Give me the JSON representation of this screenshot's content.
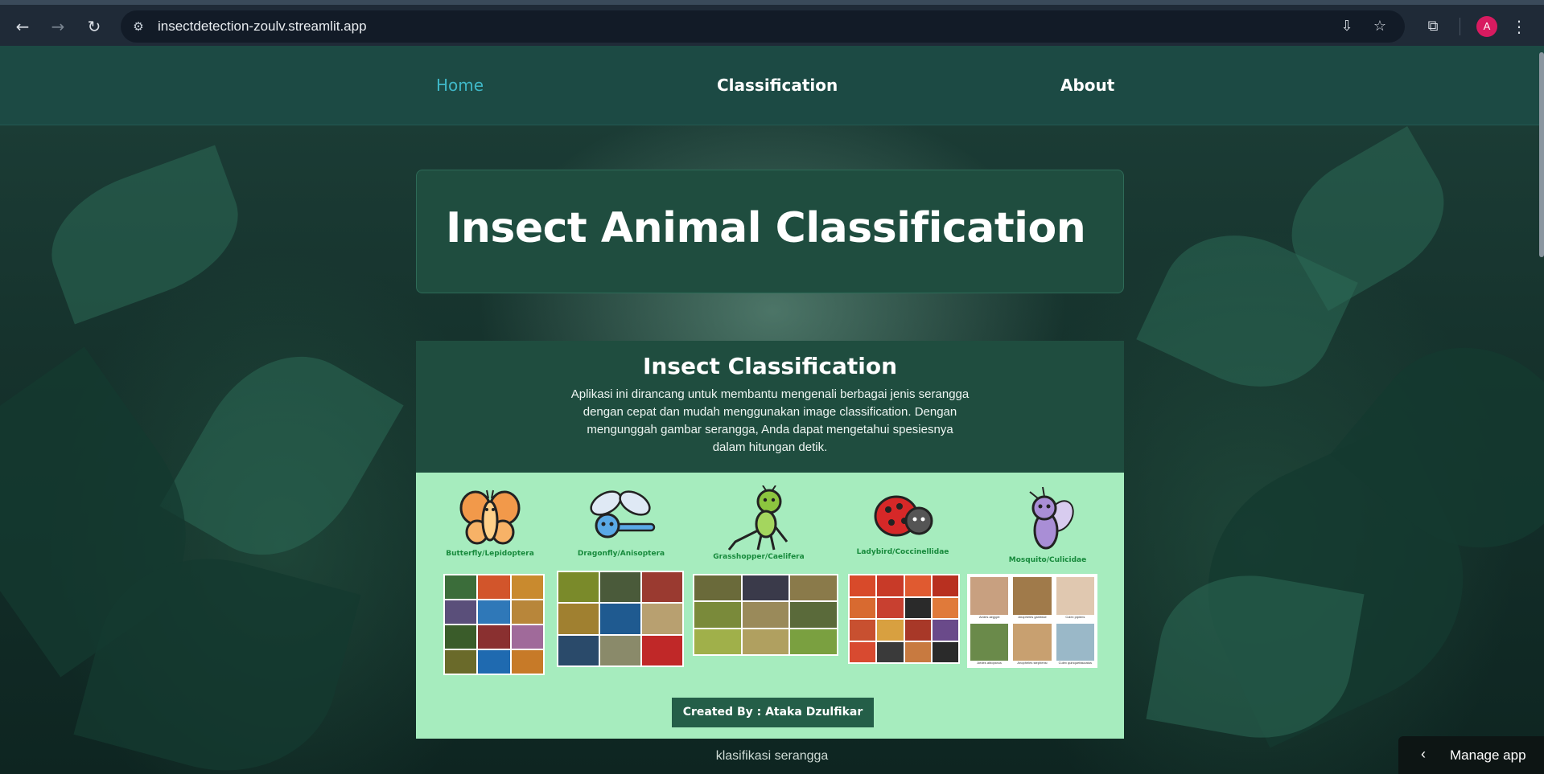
{
  "browser": {
    "url": "insectdetection-zoulv.streamlit.app",
    "back_icon": "arrow-left-icon",
    "forward_icon": "arrow-right-icon",
    "reload_icon": "reload-icon",
    "avatar_letter": "A"
  },
  "nav": {
    "items": [
      {
        "label": "Home",
        "active": true
      },
      {
        "label": "Classification",
        "active": false
      },
      {
        "label": "About",
        "active": false
      }
    ]
  },
  "title_card": {
    "title": "Insect Animal Classification"
  },
  "insect_section": {
    "heading": "Insect Classification",
    "description": "Aplikasi ini dirancang untuk membantu mengenali berbagai jenis serangga dengan cepat dan mudah menggunakan image classification. Dengan mengunggah gambar serangga, Anda dapat mengetahui spesiesnya dalam hitungan detik.",
    "insects": [
      {
        "caption": "Butterfly/Lepidoptera",
        "mascot": "butterfly-icon",
        "color": "#f2994a"
      },
      {
        "caption": "Dragonfly/Anisoptera",
        "mascot": "dragonfly-icon",
        "color": "#5aa9e6"
      },
      {
        "caption": "Grasshopper/Caelifera",
        "mascot": "grasshopper-icon",
        "color": "#8cc63f"
      },
      {
        "caption": "Ladybird/Coccinellidae",
        "mascot": "ladybird-icon",
        "color": "#d62828"
      },
      {
        "caption": "Mosquito/Culicidae",
        "mascot": "mosquito-icon",
        "color": "#a98ed6"
      }
    ],
    "mosquito_labels": [
      "Aedes aegypti",
      "Anopheles gambiae",
      "Culex pipiens",
      "Aedes albopictus",
      "Anopheles stephensi",
      "Culex quinquefasciatus"
    ],
    "credit": "Created By : Ataka Dzulfikar"
  },
  "footer": {
    "text": "klasifikasi serangga"
  },
  "manage_app": {
    "label": "Manage app"
  },
  "colors": {
    "nav_bg": "#1c4a44",
    "nav_active": "#3fb8c8",
    "card_bg": "#1f4d3f",
    "mint": "#a6ecbe",
    "caption_green": "#178a3c"
  }
}
